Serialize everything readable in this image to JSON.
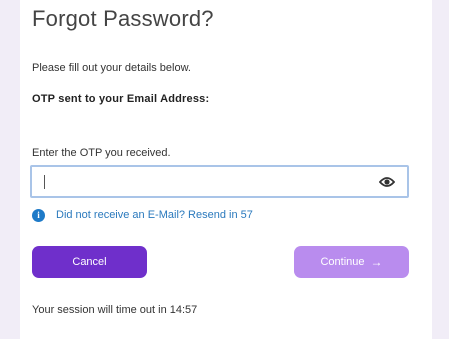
{
  "page": {
    "title": "Forgot Password?",
    "subtitle": "Please fill out your details below.",
    "otp_heading": "OTP sent to your Email Address:"
  },
  "otp": {
    "label": "Enter the OTP you received.",
    "value": "",
    "placeholder": "",
    "toggle_icon": "eye-icon"
  },
  "resend": {
    "icon": "info-icon",
    "icon_glyph": "i",
    "text": "Did not receive an E-Mail? Resend in 57"
  },
  "buttons": {
    "cancel_label": "Cancel",
    "continue_label": "Continue",
    "continue_arrow": "→"
  },
  "session": {
    "text": "Your session will time out in 14:57"
  },
  "colors": {
    "background": "#f1edf7",
    "primary": "#6f2fcb",
    "primary_disabled": "#b98cee",
    "link": "#2a79bd",
    "info_icon": "#1e7ac8",
    "field_border": "#a9c4e8"
  }
}
